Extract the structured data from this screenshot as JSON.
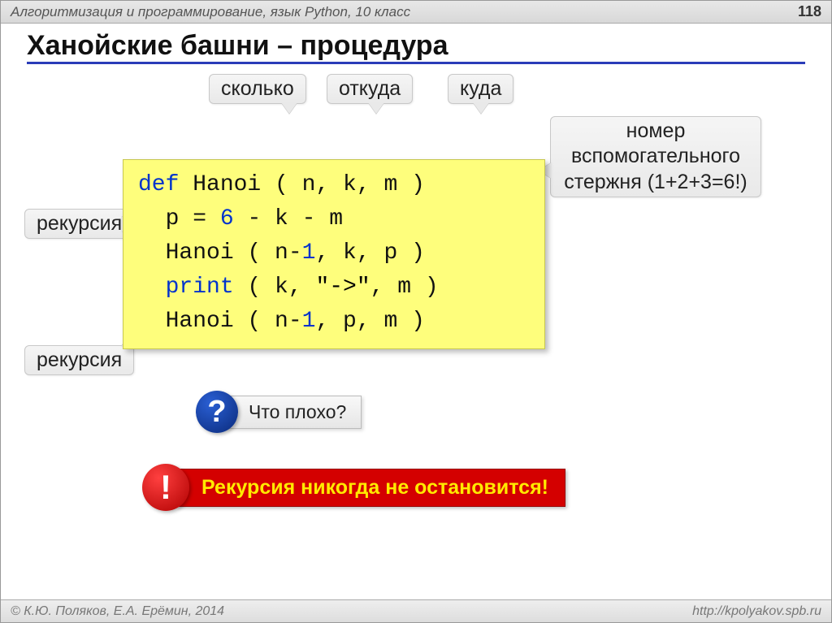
{
  "header": {
    "course": "Алгоритмизация и программирование, язык Python, 10 класс",
    "page": "118"
  },
  "title": "Ханойские башни – процедура",
  "callouts": {
    "howmany": "сколько",
    "from": "откуда",
    "to": "куда",
    "aux": "номер вспомогательного стержня (1+2+3=6!)",
    "rec1": "рекурсия",
    "rec2": "рекурсия"
  },
  "code": {
    "line1_def": "def",
    "line1_rest": " Hanoi ( n, k, m )",
    "line2_a": "  p = ",
    "line2_num": "6",
    "line2_b": " - k - m",
    "line3": "  Hanoi ( n-",
    "line3_num": "1",
    "line3_b": ", k, p )",
    "line4_print": "  print",
    "line4_rest": " ( k, ",
    "line4_str": "\"->\"",
    "line4_end": ", m )",
    "line5": "  Hanoi ( n-",
    "line5_num": "1",
    "line5_b": ", p, m )"
  },
  "question": {
    "icon": "?",
    "text": "Что плохо?"
  },
  "warning": {
    "icon": "!",
    "text": "Рекурсия никогда не остановится!"
  },
  "footer": {
    "copyright": "© К.Ю. Поляков, Е.А. Ерёмин, 2014",
    "url": "http://kpolyakov.spb.ru"
  }
}
